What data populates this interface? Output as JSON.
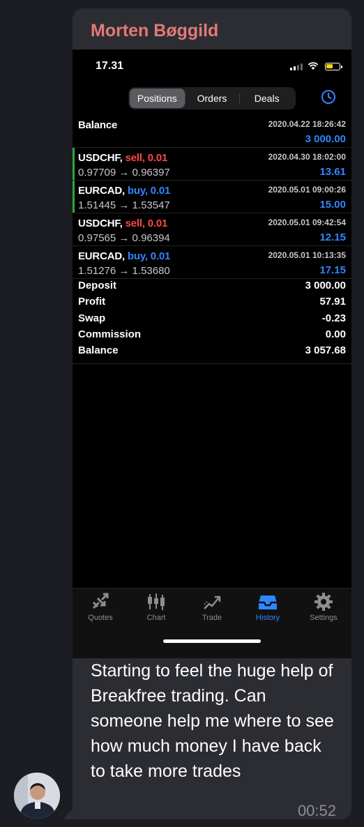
{
  "message": {
    "sender": "Morten Bøggild",
    "text": "Starting to feel the huge help of Breakfree trading. Can someone help me where to see how much money I have back to take more trades",
    "time": "00:52"
  },
  "phone": {
    "status_time": "17.31",
    "segments": [
      "Positions",
      "Orders",
      "Deals"
    ],
    "active_segment": "Positions",
    "balance_row": {
      "label": "Balance",
      "date": "2020.04.22 18:26:42",
      "amount": "3 000.00"
    },
    "trades": [
      {
        "symbol": "USDCHF,",
        "side": "sell, 0.01",
        "date": "2020.04.30 18:02:00",
        "prices": "0.97709 → 0.96397",
        "profit": "13.61"
      },
      {
        "symbol": "EURCAD,",
        "side": "buy, 0.01",
        "date": "2020.05.01 09:00:26",
        "prices": "1.51445 → 1.53547",
        "profit": "15.00"
      },
      {
        "symbol": "USDCHF,",
        "side": "sell, 0.01",
        "date": "2020.05.01 09:42:54",
        "prices": "0.97565 → 0.96394",
        "profit": "12.15"
      },
      {
        "symbol": "EURCAD,",
        "side": "buy, 0.01",
        "date": "2020.05.01 10:13:35",
        "prices": "1.51276 → 1.53680",
        "profit": "17.15"
      }
    ],
    "summary": [
      {
        "label": "Deposit",
        "value": "3 000.00"
      },
      {
        "label": "Profit",
        "value": "57.91"
      },
      {
        "label": "Swap",
        "value": "-0.23"
      },
      {
        "label": "Commission",
        "value": "0.00"
      },
      {
        "label": "Balance",
        "value": "3 057.68"
      }
    ],
    "tabs": [
      {
        "label": "Quotes",
        "icon": "quotes-icon"
      },
      {
        "label": "Chart",
        "icon": "candlestick-icon"
      },
      {
        "label": "Trade",
        "icon": "trade-icon"
      },
      {
        "label": "History",
        "icon": "inbox-icon"
      },
      {
        "label": "Settings",
        "icon": "gear-icon"
      }
    ],
    "active_tab": "History"
  },
  "colors": {
    "bubble": "#2c2d33",
    "sender": "#e37a76",
    "sell": "#ff4741",
    "buy": "#2f87ff",
    "open_marker": "#27a83a"
  }
}
